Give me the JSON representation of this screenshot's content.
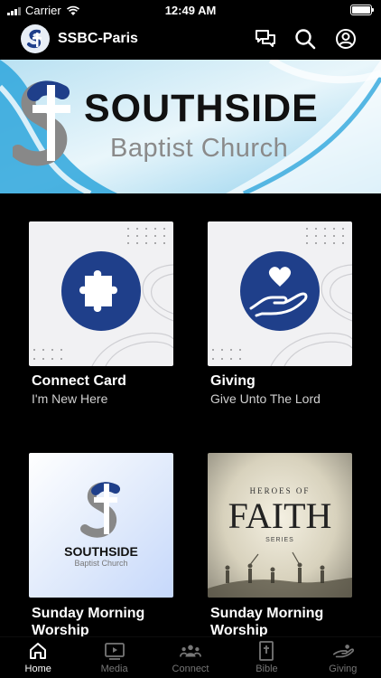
{
  "status": {
    "carrier": "Carrier",
    "time": "12:49 AM"
  },
  "header": {
    "title": "SSBC-Paris",
    "icons": [
      "chat-icon",
      "search-icon",
      "profile-icon"
    ]
  },
  "banner": {
    "title": "SOUTHSIDE",
    "subtitle": "Baptist Church"
  },
  "cards": [
    {
      "title": "Connect Card",
      "subtitle": "I'm New Here",
      "icon": "puzzle-icon"
    },
    {
      "title": "Giving",
      "subtitle": "Give Unto The Lord",
      "icon": "heart-hand-icon"
    },
    {
      "title": "Sunday Morning Worship",
      "logo_title": "SOUTHSIDE",
      "logo_sub": "Baptist Church"
    },
    {
      "title": "Sunday Morning Worship",
      "art_top": "HEROES OF",
      "art_main": "FAITH",
      "art_bottom": "SERIES"
    }
  ],
  "tabs": [
    {
      "label": "Home",
      "icon": "home-icon",
      "active": true
    },
    {
      "label": "Media",
      "icon": "media-icon",
      "active": false
    },
    {
      "label": "Connect",
      "icon": "connect-icon",
      "active": false
    },
    {
      "label": "Bible",
      "icon": "bible-icon",
      "active": false
    },
    {
      "label": "Giving",
      "icon": "giving-icon",
      "active": false
    }
  ],
  "colors": {
    "accent_blue": "#1f3f8a",
    "background": "#000000",
    "tab_inactive": "#777777"
  }
}
